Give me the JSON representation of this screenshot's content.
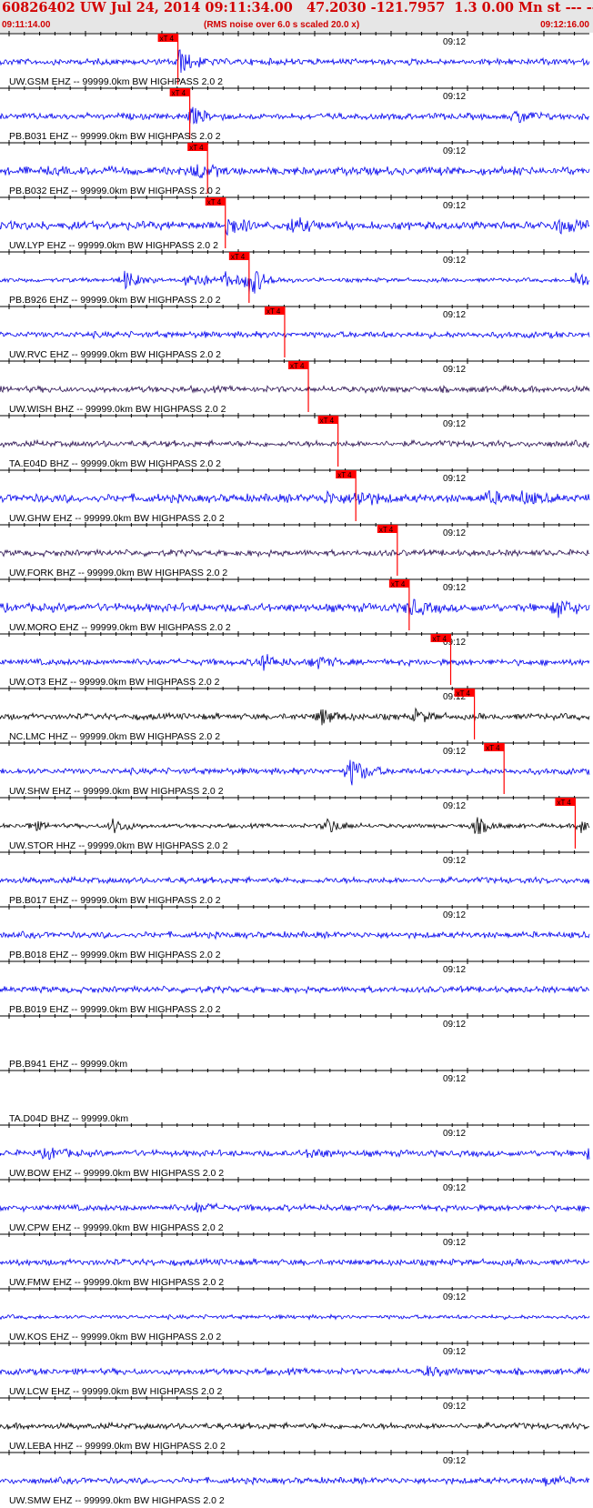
{
  "header": {
    "title": "60826402 UW Jul 24, 2014 09:11:34.00   47.2030 -121.7957  1.3 0.00 Mn st --- -- --  -1",
    "start_time": "09:11:14.00",
    "rms_note": "(RMS noise over 6.0 s scaled 20.0 x)",
    "end_time": "09:12:16.00"
  },
  "time_label": "09:12",
  "pick_label": "xT 4",
  "colors": {
    "header_bg": "#e6e6e6",
    "header_text": "#d10000",
    "blue_trace": "#0000ee",
    "dark_trace": "#2a1050",
    "black_trace": "#000000",
    "pick": "#ff0000",
    "axis": "#000000"
  },
  "traces": [
    {
      "label": "UW.GSM EHZ -- 99999.0km BW  HIGHPASS  2.0  2",
      "color": "blue_trace",
      "noise": 3,
      "pick": 0.3,
      "events": [
        [
          0.3,
          14
        ]
      ]
    },
    {
      "label": "PB.B031 EHZ -- 99999.0km BW  HIGHPASS  2.0  2",
      "color": "blue_trace",
      "noise": 3,
      "pick": 0.32,
      "events": [
        [
          0.32,
          10
        ],
        [
          0.87,
          8
        ]
      ]
    },
    {
      "label": "PB.B032 EHZ -- 99999.0km BW  HIGHPASS  2.0  2",
      "color": "blue_trace",
      "noise": 4,
      "pick": 0.35,
      "events": [
        [
          0.33,
          9
        ]
      ]
    },
    {
      "label": "UW.LYP EHZ -- 99999.0km BW  HIGHPASS  2.0  2",
      "color": "blue_trace",
      "noise": 4,
      "pick": 0.38,
      "events": [
        [
          0.38,
          12
        ],
        [
          0.49,
          8
        ],
        [
          0.94,
          8
        ]
      ]
    },
    {
      "label": "PB.B926 EHZ -- 99999.0km BW  HIGHPASS  2.0  2",
      "color": "blue_trace",
      "noise": 2,
      "pick": 0.42,
      "events": [
        [
          0.21,
          10
        ],
        [
          0.32,
          12
        ],
        [
          0.42,
          18
        ],
        [
          0.38,
          8
        ],
        [
          0.97,
          10
        ]
      ]
    },
    {
      "label": "UW.RVC EHZ -- 99999.0km BW  HIGHPASS  2.0  2",
      "color": "blue_trace",
      "noise": 3,
      "pick": 0.48,
      "events": []
    },
    {
      "label": "UW.WISH BHZ -- 99999.0km BW  HIGHPASS  2.0  2",
      "color": "dark_trace",
      "noise": 3,
      "pick": 0.52,
      "events": []
    },
    {
      "label": "TA.E04D BHZ -- 99999.0km BW  HIGHPASS  2.0  2",
      "color": "dark_trace",
      "noise": 3,
      "pick": 0.57,
      "events": []
    },
    {
      "label": "UW.GHW EHZ -- 99999.0km BW  HIGHPASS  2.0  2",
      "color": "blue_trace",
      "noise": 4,
      "pick": 0.6,
      "events": [
        [
          0.6,
          10
        ],
        [
          0.55,
          6
        ],
        [
          0.82,
          7
        ],
        [
          0.88,
          6
        ]
      ]
    },
    {
      "label": "UW.FORK BHZ -- 99999.0km BW  HIGHPASS  2.0  2",
      "color": "dark_trace",
      "noise": 3,
      "pick": 0.67,
      "events": []
    },
    {
      "label": "UW.MORO EHZ -- 99999.0km BW  HIGHPASS  2.0  2",
      "color": "blue_trace",
      "noise": 4,
      "pick": 0.69,
      "events": [
        [
          0.69,
          9
        ],
        [
          0.94,
          10
        ]
      ]
    },
    {
      "label": "UW.OT3 EHZ -- 99999.0km BW  HIGHPASS  2.0  2",
      "color": "blue_trace",
      "noise": 3,
      "pick": 0.76,
      "events": [
        [
          0.44,
          9
        ],
        [
          0.53,
          7
        ]
      ]
    },
    {
      "label": "NC.LMC HHZ -- 99999.0km BW  HIGHPASS  2.0  2",
      "color": "black_trace",
      "noise": 3,
      "pick": 0.8,
      "events": [
        [
          0.54,
          9
        ],
        [
          0.7,
          6
        ]
      ]
    },
    {
      "label": "UW.SHW EHZ -- 99999.0km BW  HIGHPASS  2.0  2",
      "color": "blue_trace",
      "noise": 3,
      "pick": 0.85,
      "events": [
        [
          0.59,
          16
        ]
      ]
    },
    {
      "label": "UW.STOR HHZ -- 99999.0km BW  HIGHPASS  2.0  2",
      "color": "black_trace",
      "noise": 2,
      "pick": 0.97,
      "events": [
        [
          0.05,
          6
        ],
        [
          0.19,
          8
        ],
        [
          0.55,
          9
        ],
        [
          0.8,
          10
        ],
        [
          0.98,
          7
        ]
      ]
    },
    {
      "label": "PB.B017 EHZ -- 99999.0km BW  HIGHPASS  2.0  2",
      "color": "blue_trace",
      "noise": 3,
      "pick": null,
      "events": []
    },
    {
      "label": "PB.B018 EHZ -- 99999.0km BW  HIGHPASS  2.0  2",
      "color": "blue_trace",
      "noise": 3,
      "pick": null,
      "events": []
    },
    {
      "label": "PB.B019 EHZ -- 99999.0km BW  HIGHPASS  2.0  2",
      "color": "blue_trace",
      "noise": 3,
      "pick": null,
      "events": []
    },
    {
      "label": "PB.B941 EHZ -- 99999.0km",
      "color": "blue_trace",
      "noise": 0,
      "pick": null,
      "events": []
    },
    {
      "label": "TA.D04D BHZ -- 99999.0km",
      "color": "blue_trace",
      "noise": 0,
      "pick": null,
      "events": []
    },
    {
      "label": "UW.BOW EHZ -- 99999.0km BW  HIGHPASS  2.0  2",
      "color": "blue_trace",
      "noise": 3,
      "pick": null,
      "events": [
        [
          0.08,
          6
        ],
        [
          0.52,
          6
        ],
        [
          0.99,
          5
        ]
      ]
    },
    {
      "label": "UW.CPW EHZ -- 99999.0km BW  HIGHPASS  2.0  2",
      "color": "blue_trace",
      "noise": 3,
      "pick": null,
      "events": [
        [
          0.33,
          5
        ]
      ]
    },
    {
      "label": "UW.FMW EHZ -- 99999.0km BW  HIGHPASS  2.0  2",
      "color": "blue_trace",
      "noise": 3,
      "pick": null,
      "events": []
    },
    {
      "label": "UW.KOS EHZ -- 99999.0km BW  HIGHPASS  2.0  2",
      "color": "blue_trace",
      "noise": 2,
      "pick": null,
      "events": []
    },
    {
      "label": "UW.LCW EHZ -- 99999.0km BW  HIGHPASS  2.0  2",
      "color": "blue_trace",
      "noise": 3,
      "pick": null,
      "events": [
        [
          0.72,
          5
        ]
      ]
    },
    {
      "label": "UW.LEBA HHZ -- 99999.0km BW  HIGHPASS  2.0  2",
      "color": "black_trace",
      "noise": 3,
      "pick": null,
      "events": []
    },
    {
      "label": "UW.SMW EHZ -- 99999.0km BW  HIGHPASS  2.0  2",
      "color": "blue_trace",
      "noise": 3,
      "pick": null,
      "events": [
        [
          0.92,
          5
        ]
      ]
    }
  ]
}
